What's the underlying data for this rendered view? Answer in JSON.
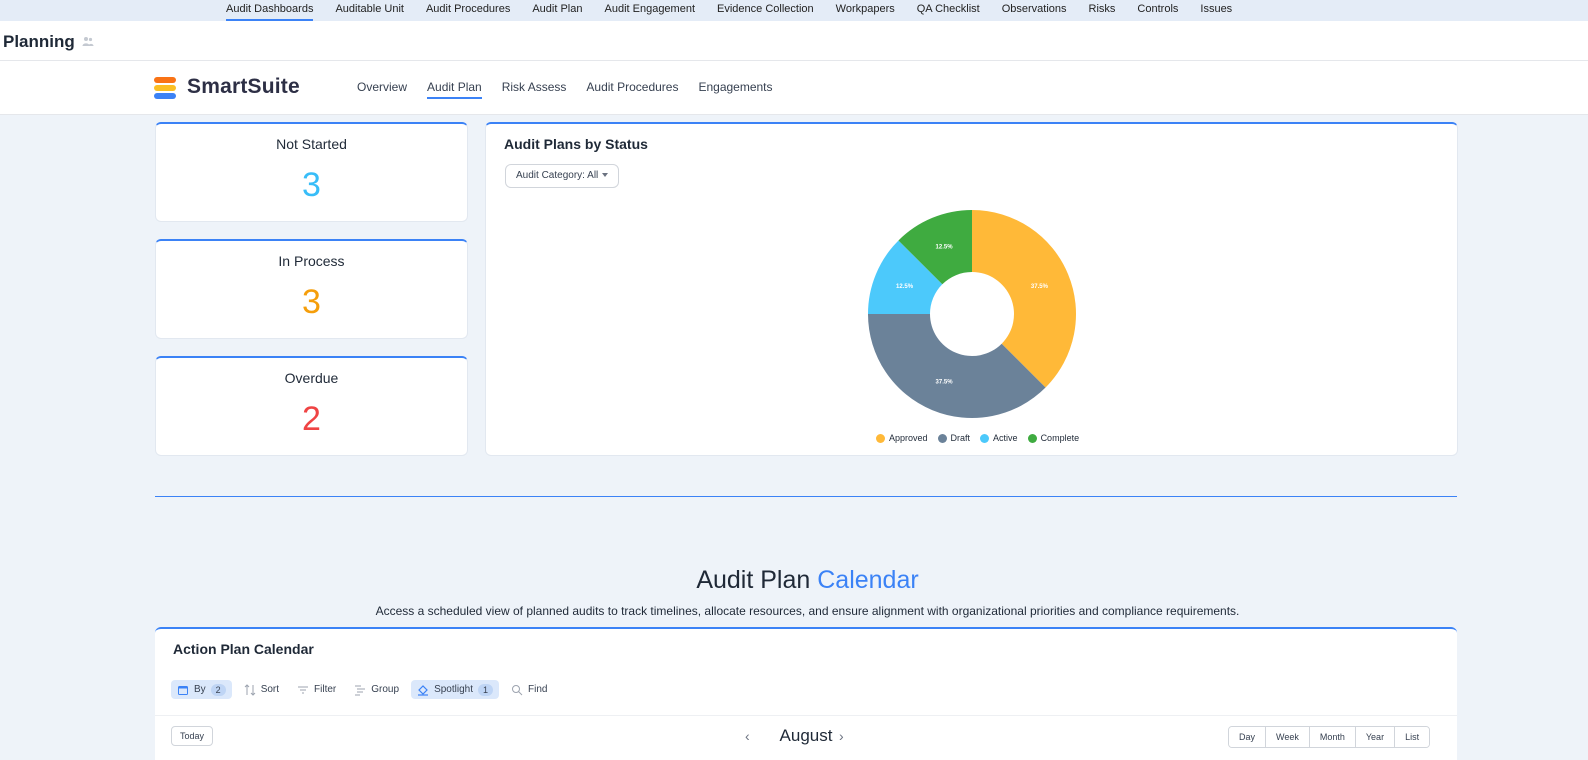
{
  "top_tabs": [
    "Audit Dashboards",
    "Auditable Unit",
    "Audit Procedures",
    "Audit Plan",
    "Audit Engagement",
    "Evidence Collection",
    "Workpapers",
    "QA Checklist",
    "Observations",
    "Risks",
    "Controls",
    "Issues"
  ],
  "page_title": "Planning",
  "brand": {
    "name": "SmartSuite",
    "colors": [
      "#f97316",
      "#fbbf24",
      "#3b82f6"
    ]
  },
  "brand_nav": [
    "Overview",
    "Audit Plan",
    "Risk Assess",
    "Audit Procedures",
    "Engagements"
  ],
  "stats": [
    {
      "label": "Not Started",
      "value": "3",
      "color": "#38bdf8"
    },
    {
      "label": "In Process",
      "value": "3",
      "color": "#f59e0b"
    },
    {
      "label": "Overdue",
      "value": "2",
      "color": "#ef4444"
    }
  ],
  "chart_panel": {
    "title": "Audit Plans by Status",
    "filter_label": "Audit Category: All"
  },
  "chart_data": {
    "type": "pie",
    "title": "Audit Plans by Status",
    "donut": true,
    "categories": [
      "Approved",
      "Draft",
      "Active",
      "Complete"
    ],
    "values": [
      37.5,
      37.5,
      12.5,
      12.5
    ],
    "labels": [
      "37.5%",
      "37.5%",
      "12.5%",
      "12.5%"
    ],
    "colors": [
      "#ffb938",
      "#6b8299",
      "#4cc9fb",
      "#3fab40"
    ],
    "legend": "bottom"
  },
  "calendar_section": {
    "title_main": "Audit Plan",
    "title_accent": "Calendar",
    "subtitle": "Access a scheduled view of planned audits to track timelines, allocate resources, and ensure alignment with organizational priorities and compliance requirements.",
    "card_title": "Action Plan Calendar",
    "toolbar": {
      "by": "By",
      "by_count": "2",
      "sort": "Sort",
      "filter": "Filter",
      "group": "Group",
      "spotlight": "Spotlight",
      "spotlight_count": "1",
      "find": "Find"
    },
    "today": "Today",
    "month": "August",
    "views": [
      "Day",
      "Week",
      "Month",
      "Year",
      "List"
    ]
  }
}
